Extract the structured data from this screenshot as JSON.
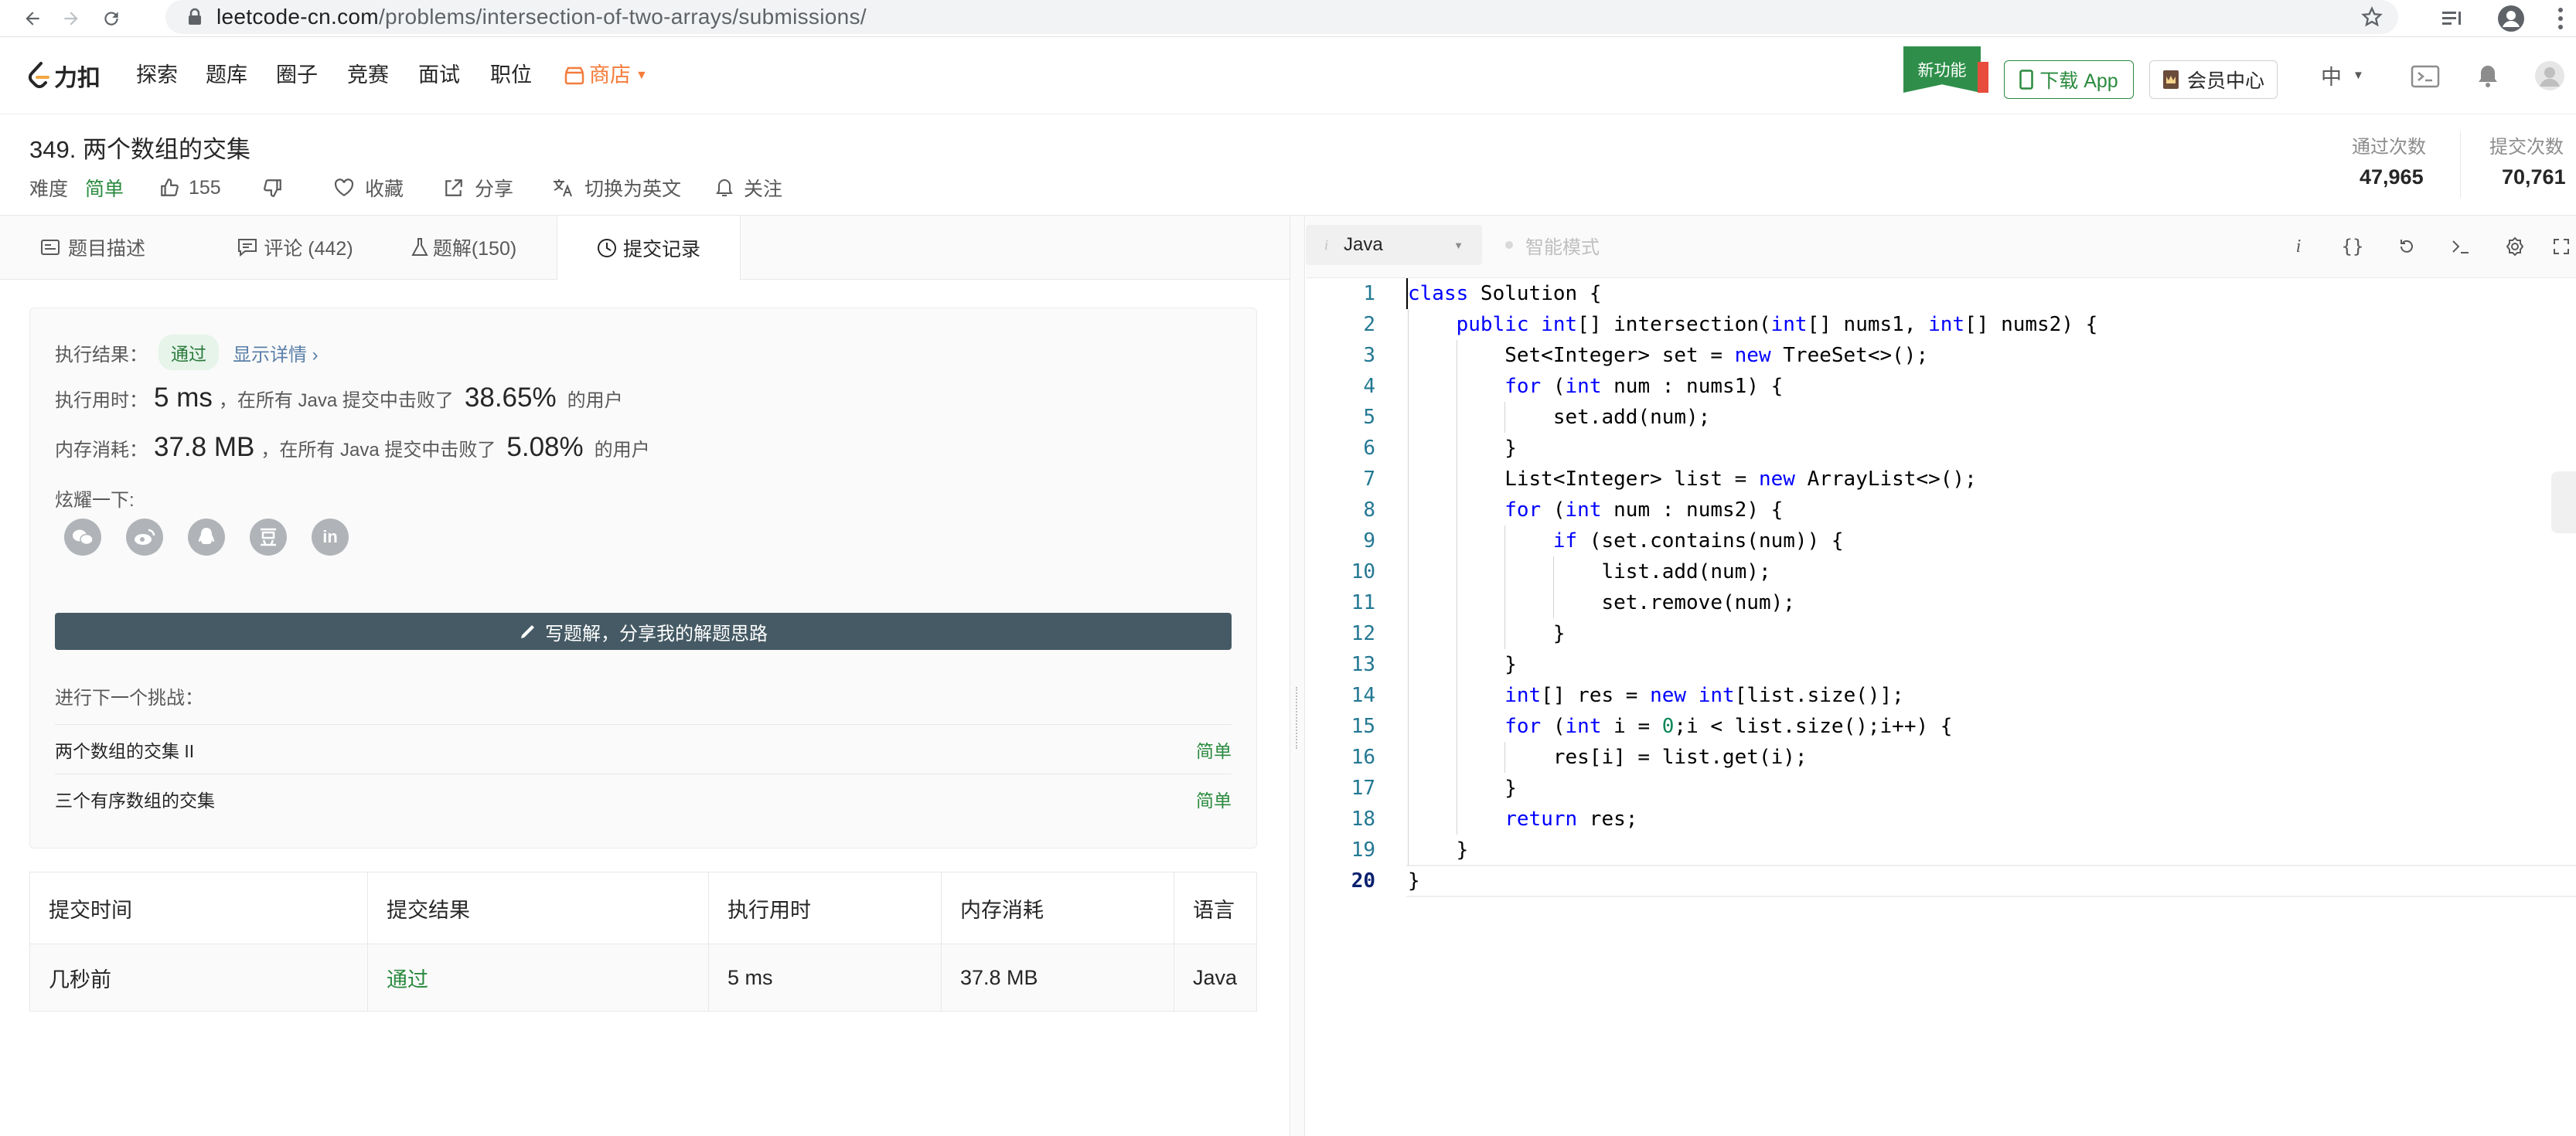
{
  "browser": {
    "url_host": "leetcode-cn.com",
    "url_path": "/problems/intersection-of-two-arrays/submissions/"
  },
  "header": {
    "logo_text": "力扣",
    "nav": [
      "探索",
      "题库",
      "圈子",
      "竞赛",
      "面试",
      "职位"
    ],
    "store_label": "商店",
    "new_feature_badge": "新功能",
    "download_app": "下载 App",
    "member_center": "会员中心",
    "language": "中"
  },
  "problem": {
    "title": "349. 两个数组的交集",
    "difficulty_label": "难度",
    "difficulty": "简单",
    "likes": "155",
    "favorite": "收藏",
    "share": "分享",
    "switch_lang": "切换为英文",
    "follow": "关注",
    "accepted_label": "通过次数",
    "accepted_value": "47,965",
    "submissions_label": "提交次数",
    "submissions_value": "70,761"
  },
  "tabs": [
    {
      "label": "题目描述",
      "icon": "description-icon"
    },
    {
      "label": "评论 (442)",
      "icon": "comment-icon"
    },
    {
      "label": "题解(150)",
      "icon": "flask-icon"
    },
    {
      "label": "提交记录",
      "icon": "clock-icon"
    }
  ],
  "result": {
    "label": "执行结果：",
    "status": "通过",
    "details_link": "显示详情 ›",
    "runtime_label": "执行用时：",
    "runtime_value": "5 ms",
    "runtime_mid": "，在所有 Java 提交中击败了",
    "runtime_pct": "38.65%",
    "users_suffix": "的用户",
    "memory_label": "内存消耗：",
    "memory_value": "37.8 MB",
    "memory_mid": "，在所有 Java 提交中击败了",
    "memory_pct": "5.08%",
    "share_label": "炫耀一下:",
    "share_icons": [
      "wechat-icon",
      "weibo-icon",
      "qq-icon",
      "douban-icon",
      "linkedin-icon"
    ],
    "write_solution": "写题解，分享我的解题思路",
    "next_challenge_label": "进行下一个挑战：",
    "next_challenges": [
      {
        "title": "两个数组的交集 II",
        "difficulty": "简单"
      },
      {
        "title": "三个有序数组的交集",
        "difficulty": "简单"
      }
    ]
  },
  "submissions_table": {
    "headers": [
      "提交时间",
      "提交结果",
      "执行用时",
      "内存消耗",
      "语言"
    ],
    "rows": [
      [
        "几秒前",
        "通过",
        "5 ms",
        "37.8 MB",
        "Java"
      ]
    ]
  },
  "editor": {
    "language": "Java",
    "smart_mode": "智能模式",
    "current_line": 20,
    "lines": [
      "class Solution {",
      "    public int[] intersection(int[] nums1, int[] nums2) {",
      "        Set<Integer> set = new TreeSet<>();",
      "        for (int num : nums1) {",
      "            set.add(num);",
      "        }",
      "        List<Integer> list = new ArrayList<>();",
      "        for (int num : nums2) {",
      "            if (set.contains(num)) {",
      "                list.add(num);",
      "                set.remove(num);",
      "            }",
      "        }",
      "        int[] res = new int[list.size()];",
      "        for (int i = 0;i < list.size();i++) {",
      "            res[i] = list.get(i);",
      "        }",
      "        return res;",
      "    }",
      "}"
    ]
  },
  "colors": {
    "accent_green": "#2a8a3e",
    "store_orange": "#f47c3c",
    "button_dark": "#455a64",
    "keyword_blue": "#0000ff",
    "number_green": "#098658"
  }
}
